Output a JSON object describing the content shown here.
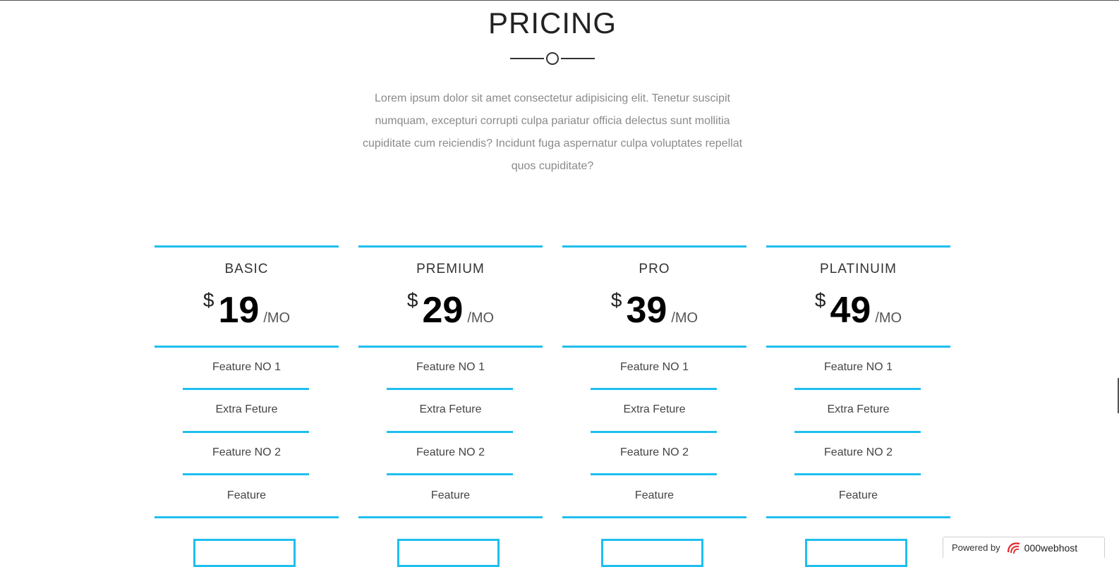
{
  "section": {
    "title": "PRICING",
    "intro": "Lorem ipsum dolor sit amet consectetur adipisicing elit. Tenetur suscipit numquam, excepturi corrupti culpa pariatur officia delectus sunt mollitia cupiditate cum reiciendis? Incidunt fuga aspernatur culpa voluptates repellat quos cupiditate?"
  },
  "accent_color": "#1fbfef",
  "plans": [
    {
      "name": "BASIC",
      "currency": "$",
      "amount": "19",
      "period": "/MO",
      "features": [
        "Feature NO 1",
        "Extra Feture",
        "Feature NO 2",
        "Feature"
      ]
    },
    {
      "name": "PREMIUM",
      "currency": "$",
      "amount": "29",
      "period": "/MO",
      "features": [
        "Feature NO 1",
        "Extra Feture",
        "Feature NO 2",
        "Feature"
      ]
    },
    {
      "name": "PRO",
      "currency": "$",
      "amount": "39",
      "period": "/MO",
      "features": [
        "Feature NO 1",
        "Extra Feture",
        "Feature NO 2",
        "Feature"
      ]
    },
    {
      "name": "PLATINUIM",
      "currency": "$",
      "amount": "49",
      "period": "/MO",
      "features": [
        "Feature NO 1",
        "Extra Feture",
        "Feature NO 2",
        "Feature"
      ]
    }
  ],
  "footer_badge": {
    "powered_label": "Powered by",
    "brand": "000webhost",
    "icon": "000webhost-logo-icon"
  }
}
